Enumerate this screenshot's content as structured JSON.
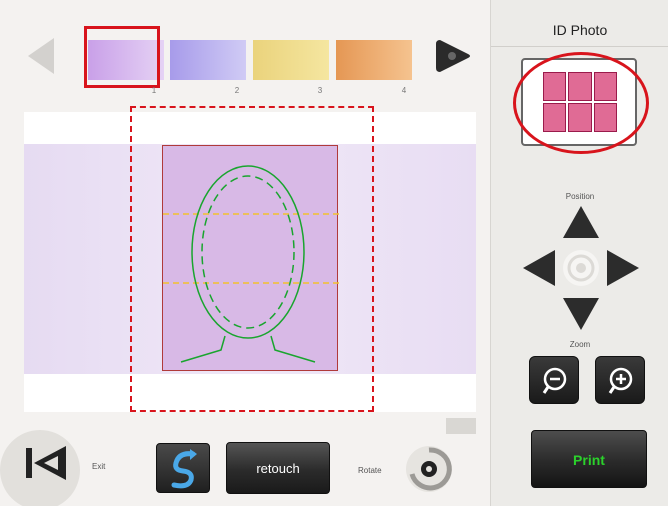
{
  "panel": {
    "title": "ID Photo"
  },
  "swatches": [
    {
      "num": "1",
      "color_from": "#c9a0e8",
      "color_to": "#e5d2f5"
    },
    {
      "num": "2",
      "color_from": "#a79bea",
      "color_to": "#d0cbf5"
    },
    {
      "num": "3",
      "color_from": "#ead37c",
      "color_to": "#f5e6a0"
    },
    {
      "num": "4",
      "color_from": "#e59754",
      "color_to": "#f5c38f"
    }
  ],
  "position": {
    "label": "Position"
  },
  "zoom": {
    "label": "Zoom"
  },
  "toolbar": {
    "exit_label": "Exit",
    "retouch_label": "retouch",
    "rotate_label": "Rotate",
    "print_label": "Print"
  },
  "colors": {
    "accent_red": "#d8141c",
    "print_green": "#2bd12b",
    "guide_green": "#19a52e",
    "guide_yellow": "#f2c12e"
  },
  "icons": {
    "prev": "chevron-left-icon",
    "next": "chevron-right-icon",
    "exit": "skip-back-icon",
    "reset": "refresh-icon",
    "rotate": "rotate-icon",
    "zoom_out": "zoom-out-icon",
    "zoom_in": "zoom-in-icon"
  }
}
